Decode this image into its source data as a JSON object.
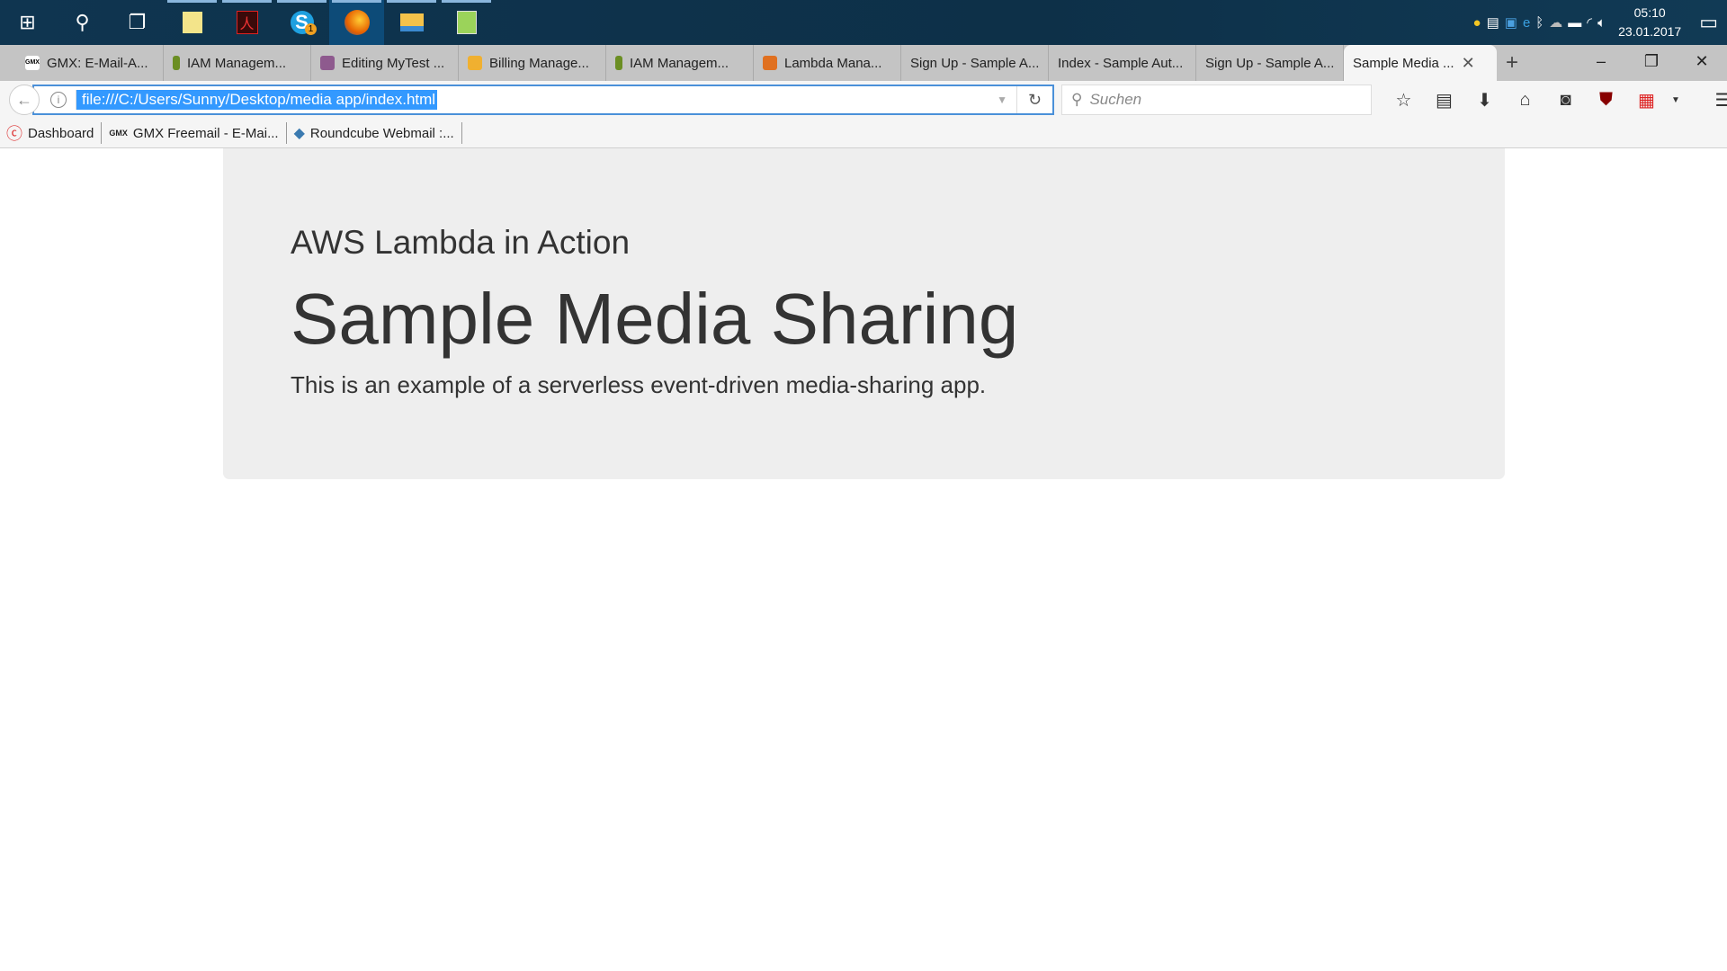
{
  "taskbar": {
    "apps": [
      {
        "name": "start",
        "icon": "windows-icon"
      },
      {
        "name": "search",
        "icon": "search-icon"
      },
      {
        "name": "task-view",
        "icon": "task-view-icon"
      },
      {
        "name": "sticky-notes",
        "icon": "sticky-notes-icon"
      },
      {
        "name": "acrobat",
        "icon": "acrobat-icon"
      },
      {
        "name": "skype",
        "icon": "skype-icon",
        "badge": "1"
      },
      {
        "name": "firefox",
        "icon": "firefox-icon"
      },
      {
        "name": "file-explorer",
        "icon": "folder-icon"
      },
      {
        "name": "notepad-plus",
        "icon": "notepad-icon"
      }
    ],
    "clock": {
      "time": "05:10",
      "date": "23.01.2017"
    }
  },
  "tabs": [
    {
      "label": "GMX: E-Mail-A...",
      "color": "#ffffff"
    },
    {
      "label": "IAM Managem...",
      "color": "#6b8e23"
    },
    {
      "label": "Editing MyTest ...",
      "color": "#8e5a8e"
    },
    {
      "label": "Billing Manage...",
      "color": "#f0b030"
    },
    {
      "label": "IAM Managem...",
      "color": "#6b8e23"
    },
    {
      "label": "Lambda Mana...",
      "color": "#e07020"
    },
    {
      "label": "Sign Up - Sample A..."
    },
    {
      "label": "Index - Sample Aut..."
    },
    {
      "label": "Sign Up - Sample A..."
    },
    {
      "label": "Sample Media ...",
      "active": true
    }
  ],
  "navbar": {
    "url": "file:///C:/Users/Sunny/Desktop/media app/index.html",
    "search_placeholder": "Suchen"
  },
  "bookmarks": [
    {
      "label": "Dashboard"
    },
    {
      "label": "GMX Freemail - E-Mai..."
    },
    {
      "label": "Roundcube Webmail :..."
    }
  ],
  "page": {
    "subtitle": "AWS Lambda in Action",
    "title": "Sample Media Sharing",
    "description": "This is an example of a serverless event-driven media-sharing app."
  }
}
